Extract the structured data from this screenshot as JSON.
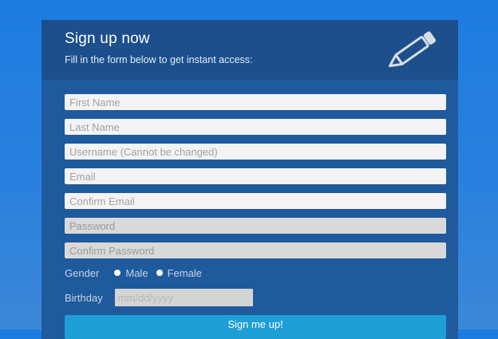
{
  "form": {
    "title": "Sign up now",
    "subtitle": "Fill in the form below to get instant access:",
    "header_icon": "pencil-icon",
    "fields": [
      {
        "name": "first-name-field",
        "placeholder": "First Name",
        "value": ""
      },
      {
        "name": "last-name-field",
        "placeholder": "Last Name",
        "value": ""
      },
      {
        "name": "username-field",
        "placeholder": "Username (Cannot be changed)",
        "value": ""
      },
      {
        "name": "email-field",
        "placeholder": "Email",
        "value": ""
      },
      {
        "name": "confirm-email-field",
        "placeholder": "Confirm Email",
        "value": ""
      },
      {
        "name": "password-field",
        "placeholder": "Password",
        "value": ""
      },
      {
        "name": "confirm-password-field",
        "placeholder": "Confirm Password",
        "value": ""
      }
    ],
    "gender": {
      "label": "Gender",
      "options": [
        {
          "label": "Male"
        },
        {
          "label": "Female"
        }
      ]
    },
    "birthday": {
      "label": "Birthday",
      "placeholder": "mm/dd/yyyy"
    },
    "submit_label": "Sign me up!"
  },
  "colors": {
    "page_background": "#1c7ce0",
    "card_background": "#1f5a9c",
    "header_background": "#1c4f8c",
    "input_background": "#f3f3f3",
    "button_background": "#1d9fd6"
  }
}
